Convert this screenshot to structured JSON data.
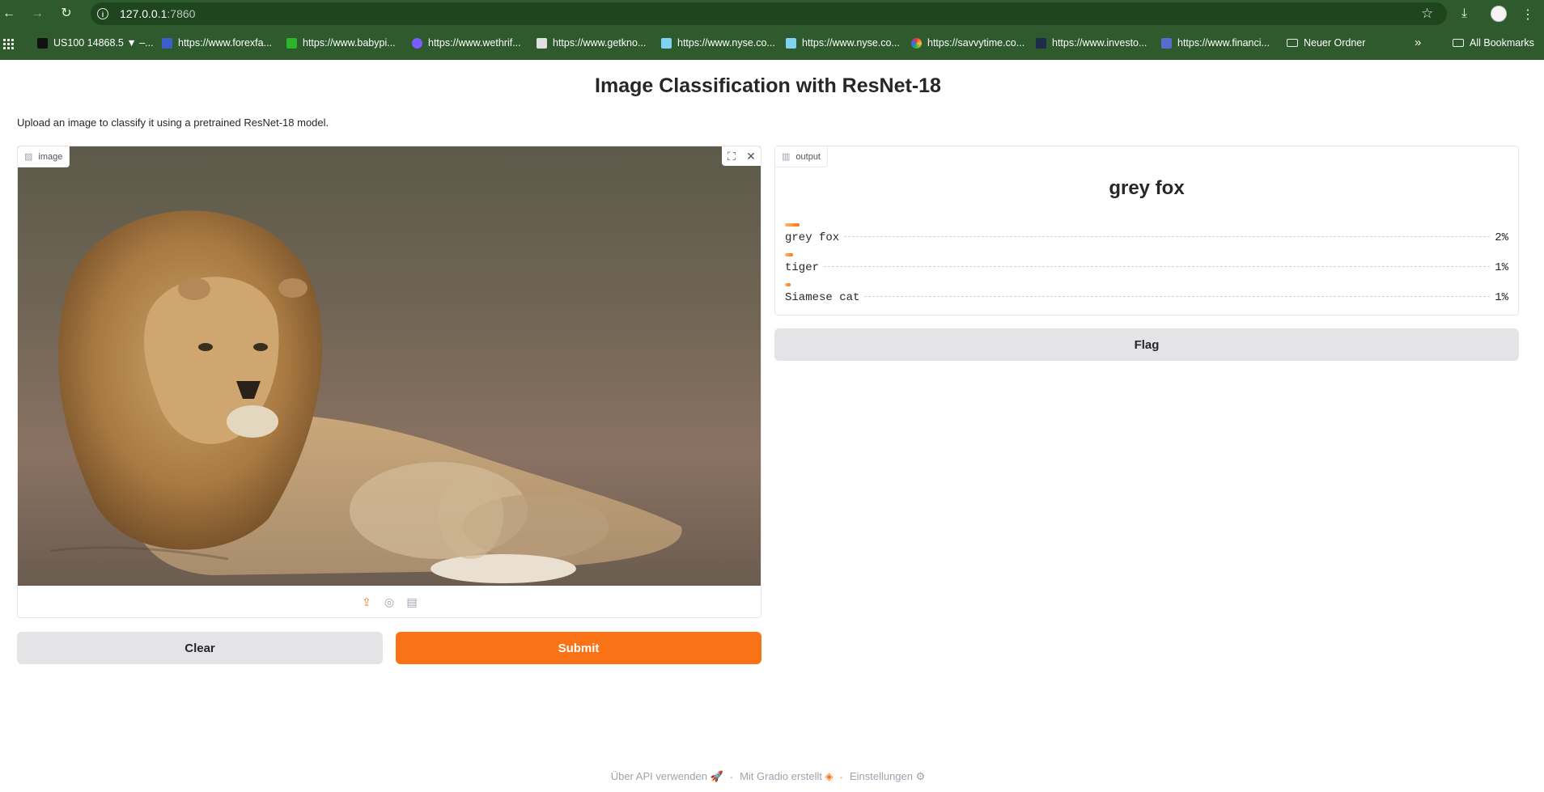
{
  "browser": {
    "url_host": "127.0.0.1",
    "url_port": ":7860",
    "bookmarks": [
      {
        "label": "US100 14868.5 ▼ –...",
        "color": "#111111"
      },
      {
        "label": "https://www.forexfa...",
        "color": "#3a5fcd"
      },
      {
        "label": "https://www.babypi...",
        "color": "#2bb52b"
      },
      {
        "label": "https://www.wethrif...",
        "color": "#7b5cff"
      },
      {
        "label": "https://www.getkno...",
        "color": "#e0e0e0"
      },
      {
        "label": "https://www.nyse.co...",
        "color": "#7fd2f0"
      },
      {
        "label": "https://www.nyse.co...",
        "color": "#7fd2f0"
      },
      {
        "label": "https://savvytime.co...",
        "color": "#f0a030"
      },
      {
        "label": "https://www.investo...",
        "color": "#1e2b4a"
      },
      {
        "label": "https://www.financi...",
        "color": "#5a6acd"
      },
      {
        "label": "Neuer Ordner",
        "color": ""
      }
    ],
    "all_bookmarks": "All Bookmarks",
    "overflow": "»"
  },
  "page": {
    "title": "Image Classification with ResNet-18",
    "description": "Upload an image to classify it using a pretrained ResNet-18 model."
  },
  "input": {
    "label": "image",
    "clear_label": "Clear",
    "submit_label": "Submit"
  },
  "output": {
    "label": "output",
    "top_class": "grey fox",
    "confidences": [
      {
        "label": "grey fox",
        "pct": "2%",
        "value": 0.02
      },
      {
        "label": "tiger",
        "pct": "1%",
        "value": 0.011
      },
      {
        "label": "Siamese cat",
        "pct": "1%",
        "value": 0.008
      }
    ],
    "flag_label": "Flag"
  },
  "footer": {
    "api": "Über API verwenden",
    "gradio": "Mit Gradio erstellt",
    "settings": "Einstellungen",
    "separator": "·"
  },
  "colors": {
    "accent": "#f97316",
    "chrome": "#2e5a2e"
  }
}
